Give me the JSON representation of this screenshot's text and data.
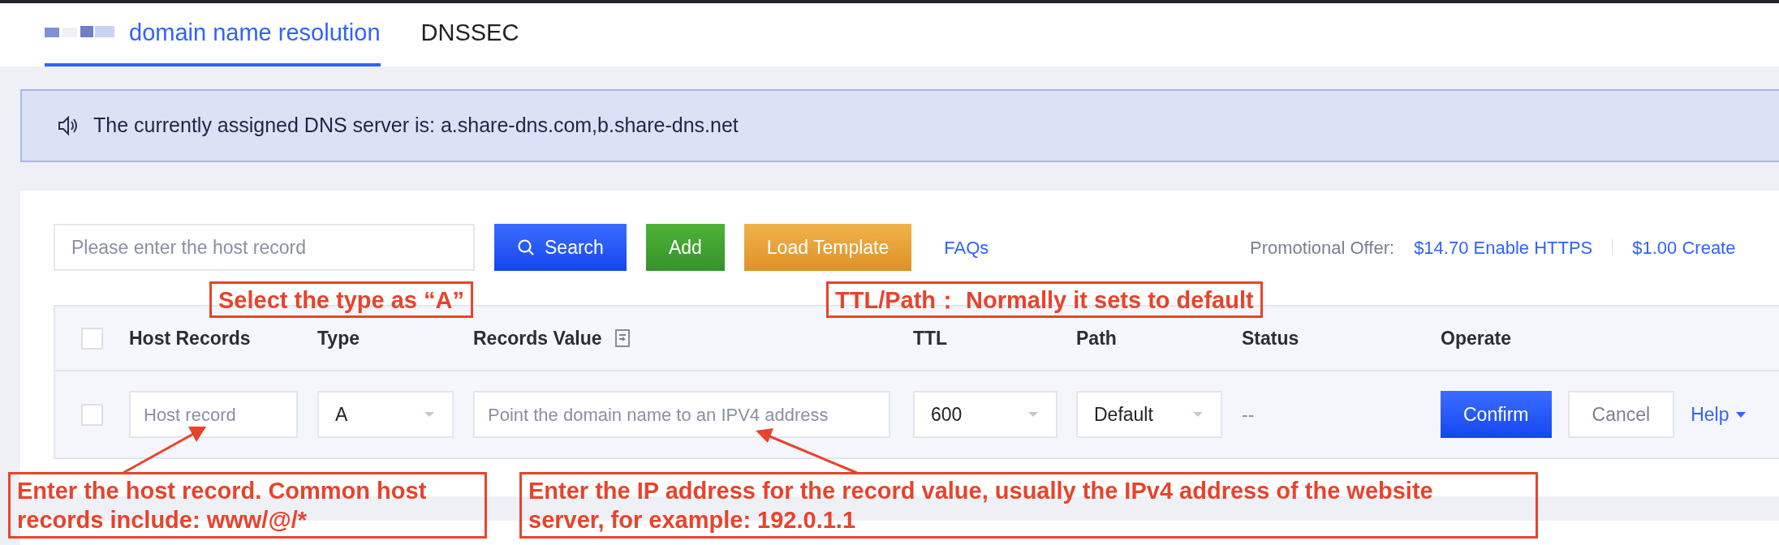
{
  "tabs": [
    {
      "label": "domain name resolution",
      "selected": true,
      "redacted": true
    },
    {
      "label": "DNSSEC",
      "selected": false,
      "redacted": false
    }
  ],
  "notice": {
    "text": "The currently assigned DNS server is: a.share-dns.com,b.share-dns.net"
  },
  "toolbar": {
    "search": {
      "placeholder": "Please enter the host record"
    },
    "buttons": [
      {
        "label": "Search",
        "kind": "primary"
      },
      {
        "label": "Add",
        "kind": "success"
      },
      {
        "label": "Load Template",
        "kind": "warning"
      },
      {
        "label": "FAQs",
        "kind": "link"
      }
    ],
    "promo_label": "Promotional Offer:",
    "promo_links": [
      "$14.70 Enable HTTPS",
      "$1.00 Create"
    ]
  },
  "table": {
    "header_checked": false,
    "columns": [
      {
        "label": "Host Records",
        "kind": "plain"
      },
      {
        "label": "Type",
        "kind": "plain"
      },
      {
        "label": "Records Value",
        "kind": "with_icon"
      },
      {
        "label": "TTL",
        "kind": "plain"
      },
      {
        "label": "Path",
        "kind": "plain"
      },
      {
        "label": "Status",
        "kind": "plain"
      },
      {
        "label": "Operate",
        "kind": "plain"
      }
    ],
    "row": {
      "checked": false,
      "cells": [
        {
          "kind": "input",
          "placeholder": "Host record"
        },
        {
          "kind": "select",
          "value": "A"
        },
        {
          "kind": "input",
          "placeholder": "Point the domain name to an IPV4 address"
        },
        {
          "kind": "select",
          "value": "600"
        },
        {
          "kind": "select",
          "value": "Default"
        },
        {
          "kind": "text",
          "value": "--"
        },
        {
          "kind": "actions",
          "buttons": [
            {
              "label": "Confirm",
              "kind": "primary"
            },
            {
              "label": "Cancel",
              "kind": "default"
            },
            {
              "label": "Help",
              "kind": "dropdown"
            }
          ]
        }
      ]
    }
  },
  "annotations": [
    {
      "text": "Select the type as “A”"
    },
    {
      "text": "TTL/Path： Normally it sets to default"
    },
    {
      "text": "Enter the host record. Common host records include: www/@/*"
    },
    {
      "text": "Enter the IP address for the record value, usually the IPv4 address of the website server, for example: 192.0.1.1"
    }
  ]
}
